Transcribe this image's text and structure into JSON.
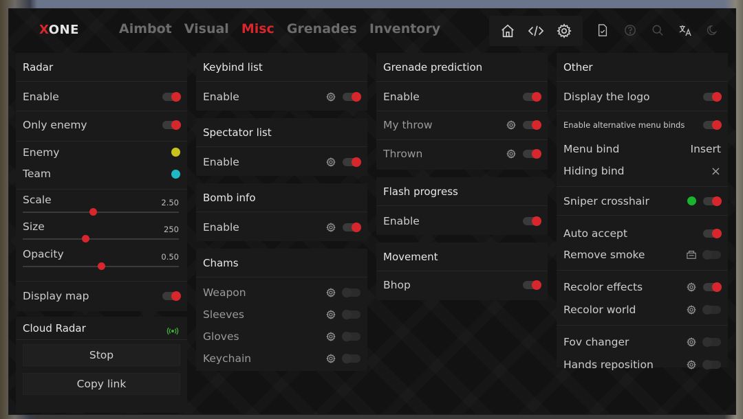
{
  "app": {
    "logo_x": "X",
    "logo_rest": "ONE"
  },
  "tabs": [
    {
      "label": "Aimbot",
      "active": false
    },
    {
      "label": "Visual",
      "active": false
    },
    {
      "label": "Misc",
      "active": true
    },
    {
      "label": "Grenades",
      "active": false
    },
    {
      "label": "Inventory",
      "active": false
    }
  ],
  "header_icons": [
    "home-icon",
    "code-icon",
    "gear-icon",
    "file-check-icon",
    "help-icon",
    "search-icon",
    "translate-icon",
    "moon-icon"
  ],
  "colors": {
    "accent": "#d8262d",
    "enemy": "#c8c21c",
    "team": "#1fb8c4",
    "sniper": "#19b42c",
    "cloud": "#3fae3a"
  },
  "radar": {
    "title": "Radar",
    "enable": {
      "label": "Enable",
      "on": true
    },
    "only_enemy": {
      "label": "Only enemy",
      "on": true
    },
    "enemy": {
      "label": "Enemy"
    },
    "team": {
      "label": "Team"
    },
    "scale": {
      "label": "Scale",
      "value": "2.50",
      "fraction": 0.45
    },
    "size": {
      "label": "Size",
      "value": "250",
      "fraction": 0.4
    },
    "opacity": {
      "label": "Opacity",
      "value": "0.50",
      "fraction": 0.5
    },
    "display_map": {
      "label": "Display map",
      "on": true
    }
  },
  "cloud_radar": {
    "title": "Cloud Radar",
    "stop": "Stop",
    "copy": "Copy link"
  },
  "keybind_list": {
    "title": "Keybind list",
    "enable": {
      "label": "Enable",
      "on": true
    }
  },
  "spectator_list": {
    "title": "Spectator list",
    "enable": {
      "label": "Enable",
      "on": true
    }
  },
  "bomb_info": {
    "title": "Bomb info",
    "enable": {
      "label": "Enable",
      "on": true
    }
  },
  "chams": {
    "title": "Chams",
    "weapon": {
      "label": "Weapon",
      "on": false
    },
    "sleeves": {
      "label": "Sleeves",
      "on": false
    },
    "gloves": {
      "label": "Gloves",
      "on": false
    },
    "keychain": {
      "label": "Keychain",
      "on": false
    }
  },
  "grenade_prediction": {
    "title": "Grenade prediction",
    "enable": {
      "label": "Enable",
      "on": true
    },
    "my_throw": {
      "label": "My throw",
      "on": true
    },
    "thrown": {
      "label": "Thrown",
      "on": true
    }
  },
  "flash_progress": {
    "title": "Flash progress",
    "enable": {
      "label": "Enable",
      "on": true
    }
  },
  "movement": {
    "title": "Movement",
    "bhop": {
      "label": "Bhop",
      "on": true
    }
  },
  "other": {
    "title": "Other",
    "display_logo": {
      "label": "Display the logo",
      "on": true
    },
    "alt_binds": {
      "label": "Enable alternative menu binds",
      "on": true
    },
    "menu_bind": {
      "label": "Menu bind",
      "value": "Insert"
    },
    "hiding_bind": {
      "label": "Hiding bind",
      "value": "×"
    },
    "sniper": {
      "label": "Sniper crosshair",
      "on": true
    },
    "auto_accept": {
      "label": "Auto accept",
      "on": true
    },
    "remove_smoke": {
      "label": "Remove smoke",
      "on": false
    },
    "recolor_effects": {
      "label": "Recolor effects",
      "on": true
    },
    "recolor_world": {
      "label": "Recolor world",
      "on": false
    },
    "fov_changer": {
      "label": "Fov changer",
      "on": false
    },
    "hands_reposition": {
      "label": "Hands reposition",
      "on": false
    }
  }
}
